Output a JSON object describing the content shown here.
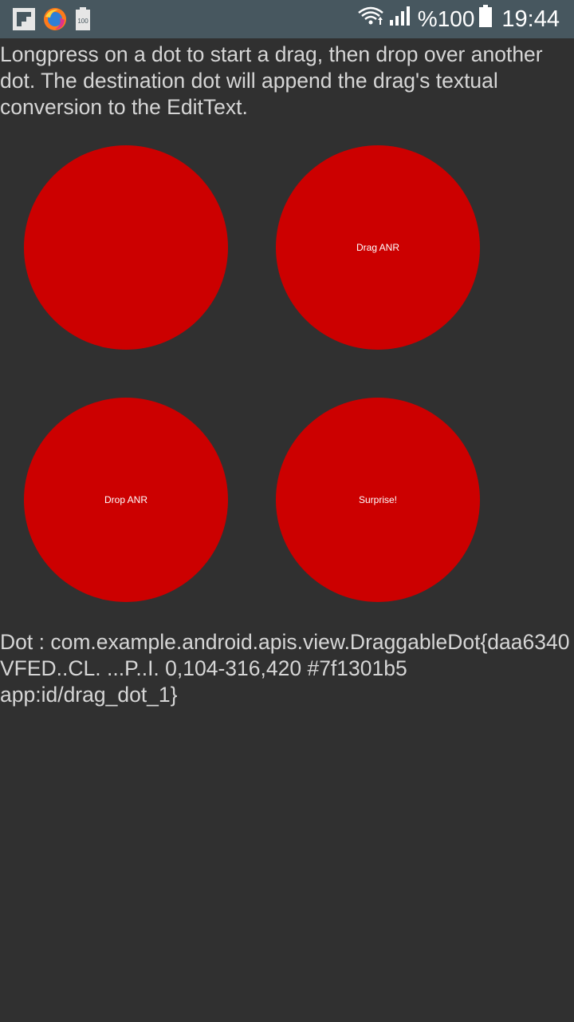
{
  "status_bar": {
    "battery_percent": "%100",
    "clock": "19:44",
    "notification_icons": [
      "flipboard-icon",
      "firefox-icon",
      "battery-notification-icon"
    ],
    "battery_notification_text": "100",
    "status_icons": [
      "wifi-icon",
      "signal-icon",
      "battery-icon"
    ]
  },
  "main": {
    "instructions": "Longpress on a dot to start a drag, then drop over another dot. The destination dot will append the drag's textual conversion to the EditText.",
    "dots": [
      {
        "label": ""
      },
      {
        "label": "Drag ANR"
      },
      {
        "label": "Drop ANR"
      },
      {
        "label": "Surprise!"
      }
    ],
    "dot_color": "#cc0000",
    "result_text": "Dot : com.example.android.apis.view.DraggableDot{daa6340 VFED..CL. ...P..I. 0,104-316,420 #7f1301b5 app:id/drag_dot_1}"
  }
}
